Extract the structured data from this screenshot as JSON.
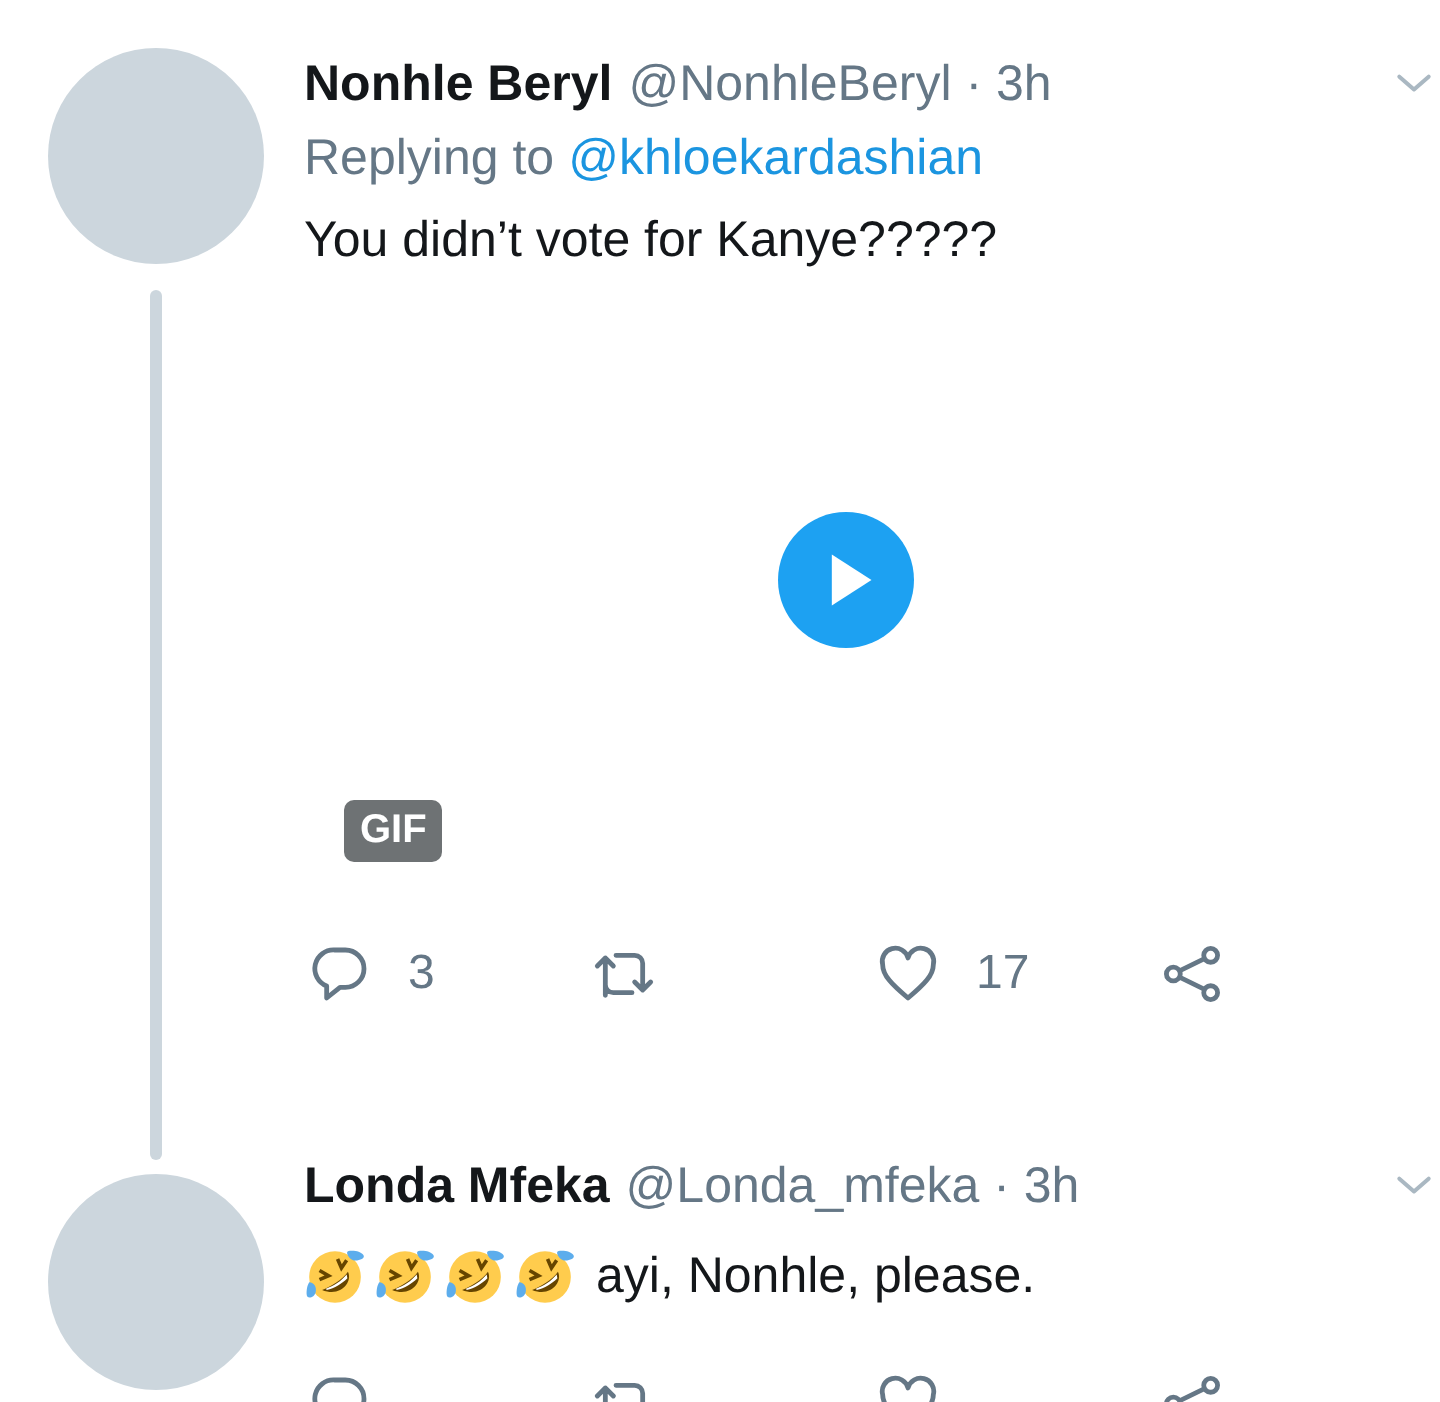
{
  "tweets": [
    {
      "name": "Nonhle Beryl",
      "meta": "@NonhleBeryl · 3h",
      "thread_line": true,
      "replying_to": {
        "label": "Replying to",
        "handle": "@khloekardashian"
      },
      "text": "You didn’t vote for Kanye?????",
      "media": {
        "kind": "gif",
        "badge": "GIF"
      },
      "actions": {
        "replies": "3",
        "likes": "17"
      }
    },
    {
      "name": "Londa Mfeka",
      "meta": "@Londa_mfeka · 3h",
      "thread_line": false,
      "emoji": [
        {
          "kind": "rofl"
        },
        {
          "kind": "rofl"
        },
        {
          "kind": "rofl"
        },
        {
          "kind": "rofl"
        }
      ],
      "text": "ayi, Nonhle, please."
    }
  ]
}
